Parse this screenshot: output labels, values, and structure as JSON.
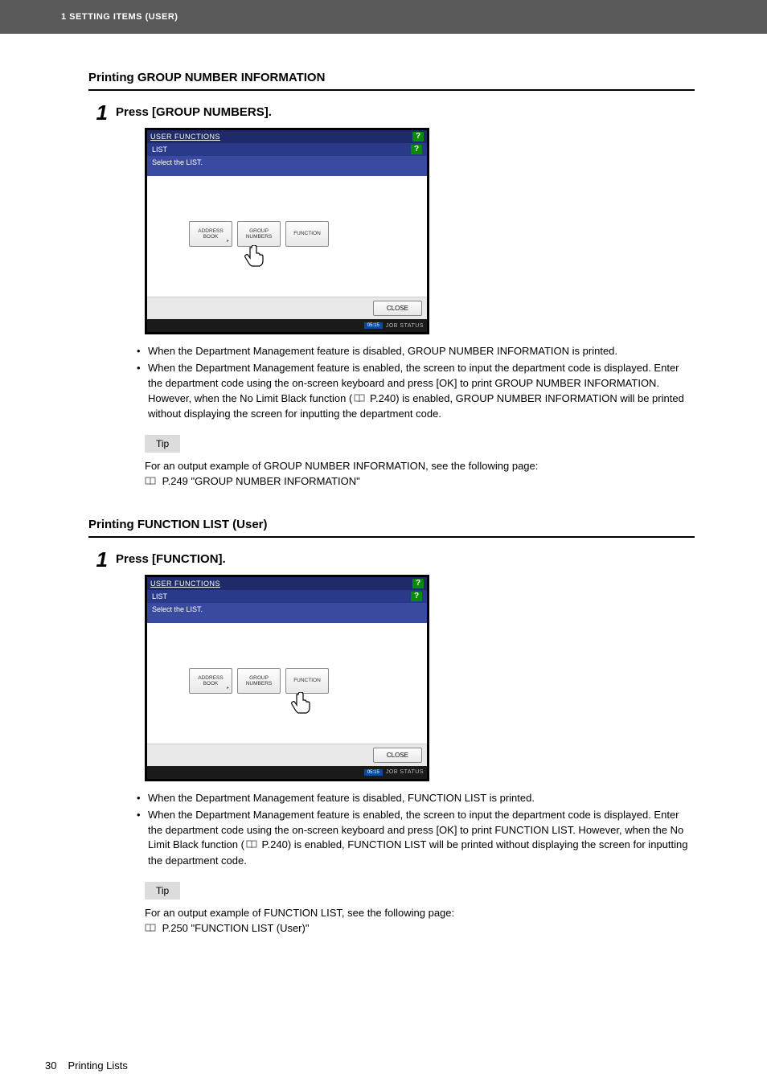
{
  "header": {
    "text": "1 SETTING ITEMS (USER)"
  },
  "sectionA": {
    "title_prefix": "Printing ",
    "title_main": "GROUP NUMBER INFORMATION",
    "step_number": "1",
    "step_title": "Press [GROUP NUMBERS].",
    "shot": {
      "title": "USER FUNCTIONS",
      "list_label": "LIST",
      "instruction": "Select the LIST.",
      "btn1": "ADDRESS\nBOOK",
      "btn2": "GROUP\nNUMBERS",
      "btn3": "FUNCTION",
      "close": "CLOSE",
      "time": "05:15",
      "jobstatus": "JOB STATUS"
    },
    "bullets": [
      "When the Department Management feature is disabled, GROUP NUMBER INFORMATION is printed.",
      "When the Department Management feature is enabled, the screen to input the department code is displayed. Enter the department code using the on-screen keyboard and press [OK] to print GROUP NUMBER INFORMATION. However, when the No Limit Black function (📖 P.240) is enabled, GROUP NUMBER INFORMATION will be printed without displaying the screen for inputting the department code."
    ],
    "bullet2_part1": "When the Department Management feature is enabled, the screen to input the department code is displayed. Enter the department code using the on-screen keyboard and press [OK] to print GROUP NUMBER INFORMATION. However, when the No Limit Black function (",
    "bullet2_pref": " P.240) is enabled, GROUP NUMBER INFORMATION will be printed without displaying the screen for inputting the department code.",
    "tip_label": "Tip",
    "tip_line1": "For an output example of GROUP NUMBER INFORMATION, see the following page:",
    "tip_ref": " P.249 \"GROUP NUMBER INFORMATION\""
  },
  "sectionB": {
    "title_prefix": "Printing ",
    "title_main": "FUNCTION LIST (User)",
    "step_number": "1",
    "step_title": "Press [FUNCTION].",
    "shot": {
      "title": "USER FUNCTIONS",
      "list_label": "LIST",
      "instruction": "Select the LIST.",
      "btn1": "ADDRESS\nBOOK",
      "btn2": "GROUP\nNUMBERS",
      "btn3": "FUNCTION",
      "close": "CLOSE",
      "time": "05:15",
      "jobstatus": "JOB STATUS"
    },
    "bullet1": "When the Department Management feature is disabled, FUNCTION LIST is printed.",
    "bullet2_part1": "When the Department Management feature is enabled, the screen to input the department code is displayed. Enter the department code using the on-screen keyboard and press [OK] to print FUNCTION LIST. However, when the No Limit Black function (",
    "bullet2_pref": " P.240) is enabled, FUNCTION LIST will be printed without displaying the screen for inputting the department code.",
    "tip_label": "Tip",
    "tip_line1": "For an output example of FUNCTION LIST, see the following page:",
    "tip_ref": " P.250 \"FUNCTION LIST (User)\""
  },
  "footer": {
    "page_number": "30",
    "section": "Printing Lists"
  }
}
